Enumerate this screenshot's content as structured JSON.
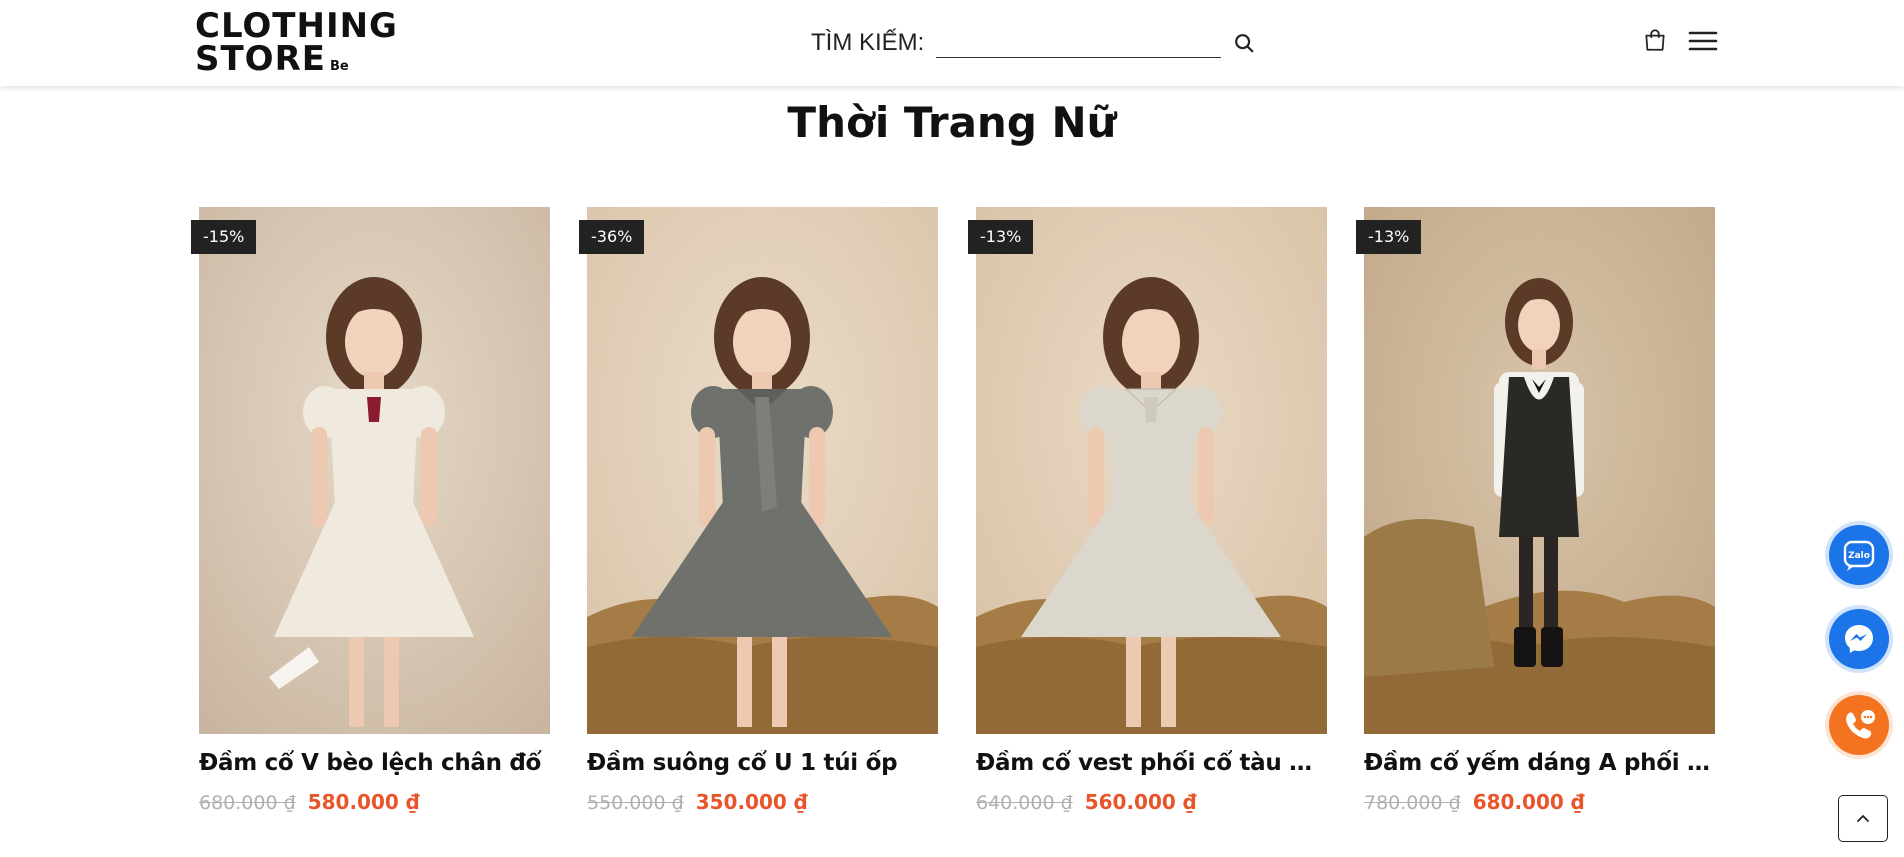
{
  "header": {
    "logo_line1": "CLOTHING",
    "logo_line2": "STORE",
    "logo_suffix": "Be",
    "search_label": "TÌM KIẾM:",
    "search_value": "",
    "search_placeholder": "",
    "icons": {
      "search": "search-icon",
      "cart": "shopping-bag-icon",
      "menu": "hamburger-menu-icon"
    }
  },
  "section": {
    "title": "Thời Trang Nữ"
  },
  "products": [
    {
      "badge": "-15%",
      "name": "Đầm cổ V bèo lệch chân đổ",
      "old_price": "680.000 ₫",
      "new_price": "580.000 ₫",
      "dress_color": "#efe9de",
      "tie_color": "#8b1b2e"
    },
    {
      "badge": "-36%",
      "name": "Đầm suông cổ U 1 túi ốp",
      "old_price": "550.000 ₫",
      "new_price": "350.000 ₫",
      "dress_color": "#6e716c",
      "tie_color": "#7c7f7a"
    },
    {
      "badge": "-13%",
      "name": "Đầm cổ vest phối cổ tàu dáng...",
      "old_price": "640.000 ₫",
      "new_price": "560.000 ₫",
      "dress_color": "#dcd7cd",
      "tie_color": "#cfc9bf"
    },
    {
      "badge": "-13%",
      "name": "Đầm cổ yếm dáng A phối áo tơ",
      "old_price": "780.000 ₫",
      "new_price": "680.000 ₫",
      "dress_color": "#2a2926",
      "tie_color": "#111111"
    }
  ],
  "floating": {
    "zalo_label": "Zalo",
    "icons": {
      "zalo": "zalo-icon",
      "messenger": "messenger-icon",
      "phone": "phone-icon",
      "scroll_top": "chevron-up-icon"
    }
  },
  "colors": {
    "accent_price": "#e8552b",
    "old_price": "#b0b0b0",
    "badge_bg": "#222222",
    "zalo": "#1b74e8",
    "messenger": "#1b74e8",
    "phone": "#f47320"
  }
}
